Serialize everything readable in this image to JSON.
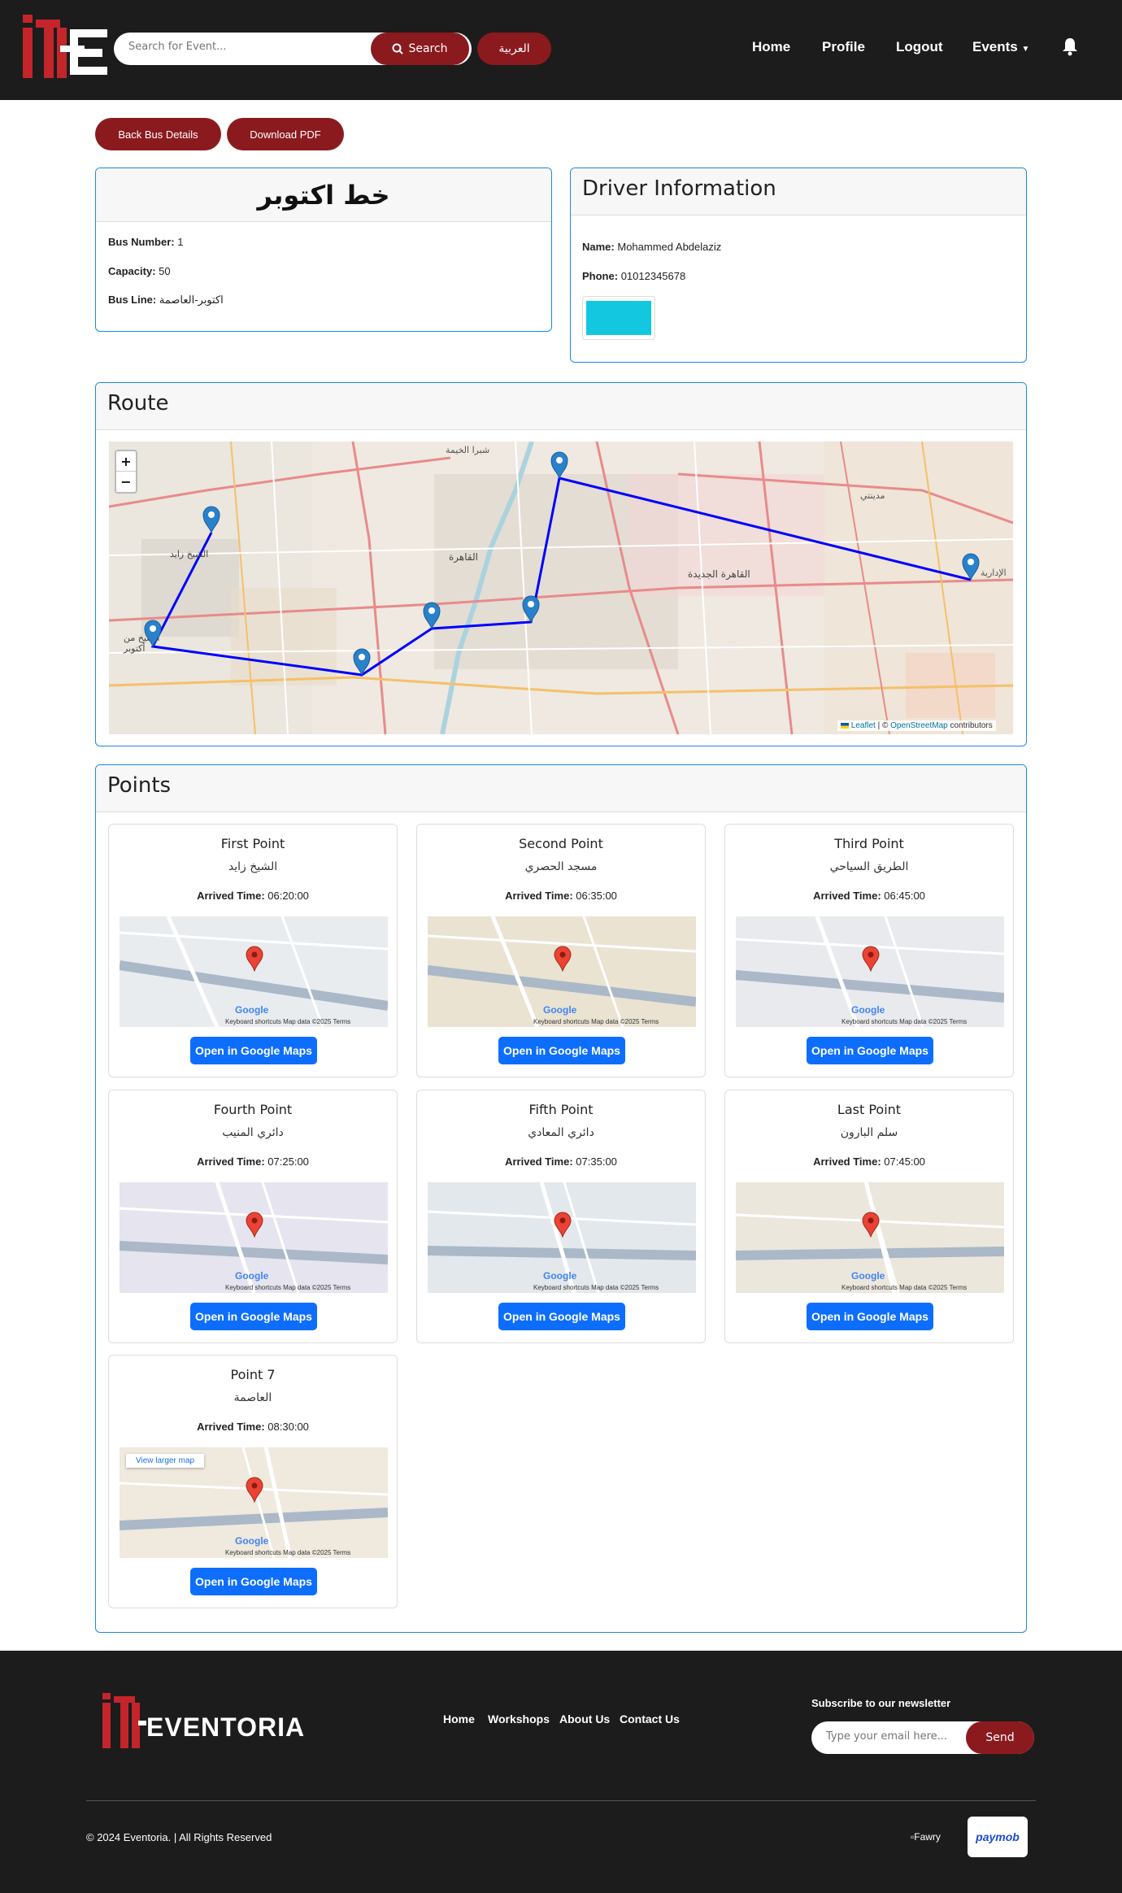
{
  "nav": {
    "search_placeholder": "Search for Event...",
    "search_label": "Search",
    "lang_label": "العربية",
    "links": {
      "home": "Home",
      "profile": "Profile",
      "logout": "Logout",
      "events": "Events"
    }
  },
  "actions": {
    "back": "Back Bus Details",
    "download": "Download PDF"
  },
  "bus": {
    "title": "خط اكتوبر",
    "number_label": "Bus Number:",
    "number": "1",
    "capacity_label": "Capacity:",
    "capacity": "50",
    "line_label": "Bus Line:",
    "line": "اكتوبر-العاصمة"
  },
  "driver": {
    "heading": "Driver Information",
    "name_label": "Name:",
    "name": "Mohammed Abdelaziz",
    "phone_label": "Phone:",
    "phone": "01012345678"
  },
  "route": {
    "heading": "Route",
    "zoom_in": "+",
    "zoom_out": "−",
    "attribution_leaflet": "Leaflet",
    "attribution_sep": "| ©",
    "attribution_osm": "OpenStreetMap",
    "attribution_tail": "contributors",
    "map_labels": [
      "شبرا الخيمة",
      "القاهرة",
      "القاهرة الجديدة",
      "الشيخ زايد",
      "الشيخ من أكتوبر",
      "مدينتي",
      "الإدارية"
    ]
  },
  "points": {
    "heading": "Points",
    "arrived_label": "Arrived Time:",
    "button_label": "Open in Google Maps",
    "map_footer": "Keyboard shortcuts   Map data ©2025   Terms",
    "google": "Google",
    "larger_map": "View larger map",
    "items": [
      {
        "title": "First Point",
        "sub": "الشيخ زايد",
        "time": "06:20:00"
      },
      {
        "title": "Second Point",
        "sub": "مسجد الحصري",
        "time": "06:35:00"
      },
      {
        "title": "Third Point",
        "sub": "الطريق السياحي",
        "time": "06:45:00"
      },
      {
        "title": "Fourth Point",
        "sub": "دائري المنيب",
        "time": "07:25:00"
      },
      {
        "title": "Fifth Point",
        "sub": "دائري المعادي",
        "time": "07:35:00"
      },
      {
        "title": "Last Point",
        "sub": "سلم البارون",
        "time": "07:45:00"
      },
      {
        "title": "Point 7",
        "sub": "العاصمة",
        "time": "08:30:00"
      }
    ]
  },
  "footer": {
    "brand": "EVENTORIA",
    "links": {
      "home": "Home",
      "workshops": "Workshops",
      "about": "About Us",
      "contact": "Contact Us"
    },
    "newsletter_title": "Subscribe to our newsletter",
    "email_placeholder": "Type your email here...",
    "send": "Send",
    "copyright": "© 2024 Eventoria. | All Rights Reserved",
    "fawry": "Fawry",
    "paymob": "paymob"
  },
  "colors": {
    "brand_red": "#8b1a1f",
    "nav_bg": "#1c1c1c",
    "card_border": "#1e88e5",
    "route_line": "#0000ff",
    "google_btn": "#0d6efd"
  }
}
